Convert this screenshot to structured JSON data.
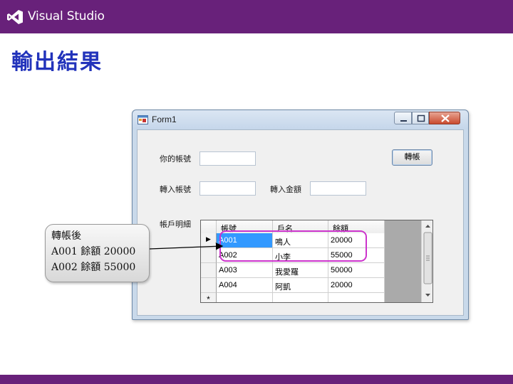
{
  "brand": {
    "name": "Visual Studio",
    "color": "#68217a",
    "logo_icon": "visual-studio-logo-icon"
  },
  "slide": {
    "title": "輸出結果",
    "title_color": "#2233bb"
  },
  "window": {
    "title": "Form1",
    "icon": "form-window-icon",
    "caption_buttons": [
      "minimize-icon",
      "maximize-icon",
      "close-icon"
    ]
  },
  "form": {
    "account_label": "你的帳號",
    "account_value": "",
    "transfer_button": "轉帳",
    "target_label": "轉入帳號",
    "target_value": "",
    "amount_label": "轉入金額",
    "amount_value": "",
    "detail_label": "帳戶明細"
  },
  "grid": {
    "columns": [
      "帳號",
      "戶名",
      "餘額"
    ],
    "rows": [
      {
        "marker": "▶",
        "cells": [
          "A001",
          "鳴人",
          "20000"
        ]
      },
      {
        "marker": "",
        "cells": [
          "A002",
          "小李",
          "55000"
        ]
      },
      {
        "marker": "",
        "cells": [
          "A003",
          "我愛羅",
          "50000"
        ]
      },
      {
        "marker": "",
        "cells": [
          "A004",
          "阿凱",
          "20000"
        ]
      },
      {
        "marker": "*",
        "cells": [
          "",
          "",
          ""
        ]
      }
    ],
    "selected_color": "#3399ff"
  },
  "callout": {
    "lines": [
      "轉帳後",
      "A001 餘額 20000",
      "A002 餘額 55000"
    ],
    "highlight_color": "#cc33cc"
  }
}
